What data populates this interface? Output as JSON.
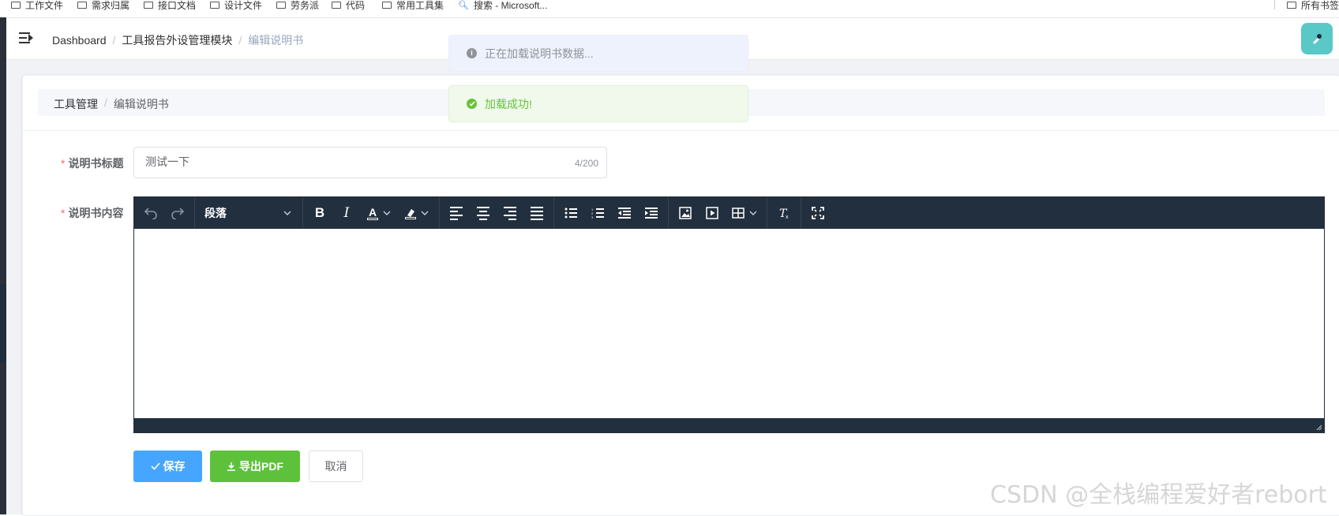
{
  "bookmarks": [
    {
      "label": "工作文件"
    },
    {
      "label": "需求归属"
    },
    {
      "label": "接口文档"
    },
    {
      "label": "设计文件"
    },
    {
      "label": "劳务派"
    },
    {
      "label": "代码"
    },
    {
      "label": "常用工具集"
    },
    {
      "label": "搜索 - Microsoft..."
    },
    {
      "label": "所有书签"
    }
  ],
  "navbar": {
    "breadcrumb": [
      "Dashboard",
      "工具报告外设管理模块",
      "编辑说明书"
    ],
    "separator": "/"
  },
  "card": {
    "breadcrumb": [
      "工具管理",
      "编辑说明书"
    ],
    "separator": "/"
  },
  "form": {
    "title_label": "说明书标题",
    "title_value": "测试一下",
    "title_counter": "4/200",
    "content_label": "说明书内容",
    "required_mark": "*"
  },
  "editor": {
    "block_format": "段落",
    "content": ""
  },
  "buttons": {
    "save": "保存",
    "export_pdf": "导出PDF",
    "cancel": "取消"
  },
  "messages": {
    "info": "正在加载说明书数据...",
    "success": "加载成功!"
  },
  "watermark": "CSDN @全栈编程爱好者rebort",
  "colors": {
    "primary": "#46a6ff",
    "success": "#5ec13c",
    "editor_toolbar": "#222f3e",
    "required": "#f56c6c"
  }
}
